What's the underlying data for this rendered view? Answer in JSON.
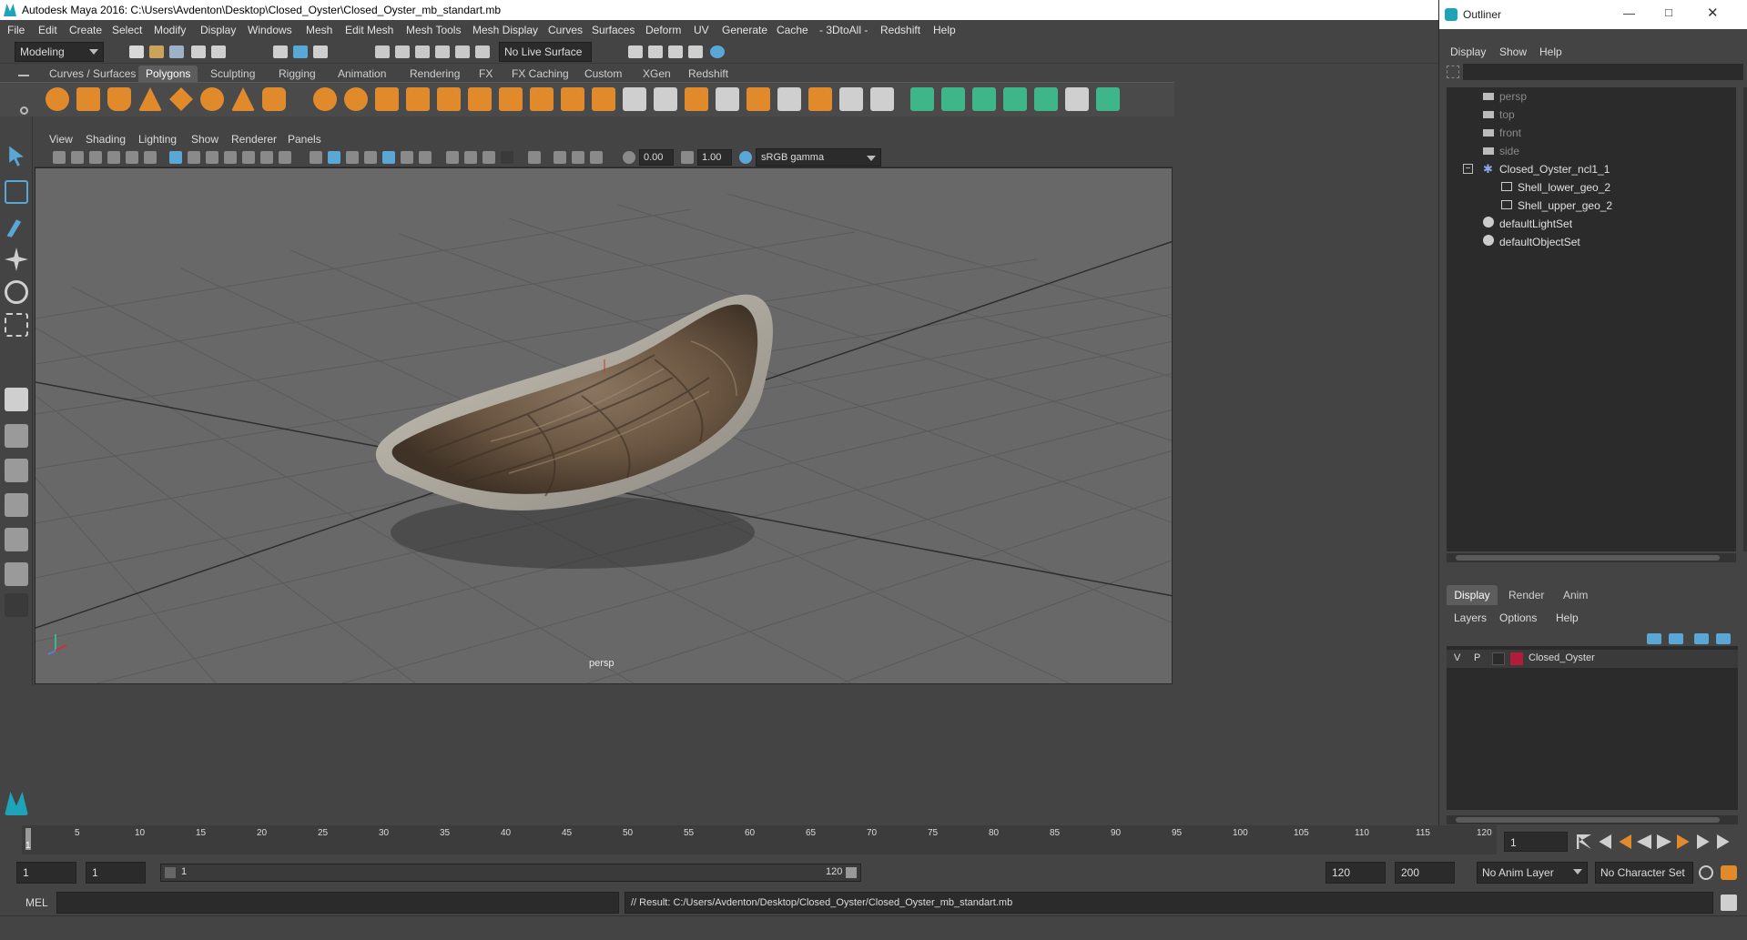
{
  "window": {
    "title": "Autodesk Maya 2016: C:\\Users\\Avdenton\\Desktop\\Closed_Oyster\\Closed_Oyster_mb_standart.mb"
  },
  "menubar": [
    "File",
    "Edit",
    "Create",
    "Select",
    "Modify",
    "Display",
    "Windows",
    "Mesh",
    "Edit Mesh",
    "Mesh Tools",
    "Mesh Display",
    "Curves",
    "Surfaces",
    "Deform",
    "UV",
    "Generate",
    "Cache",
    "- 3DtoAll -",
    "Redshift",
    "Help"
  ],
  "statusline": {
    "mode": "Modeling",
    "live_surface": "No Live Surface"
  },
  "shelf": {
    "tabs": [
      "Curves / Surfaces",
      "Polygons",
      "Sculpting",
      "Rigging",
      "Animation",
      "Rendering",
      "FX",
      "FX Caching",
      "Custom",
      "XGen",
      "Redshift"
    ],
    "active_tab": "Polygons"
  },
  "viewport": {
    "menu": [
      "View",
      "Shading",
      "Lighting",
      "Show",
      "Renderer",
      "Panels"
    ],
    "exposure": "0.00",
    "gamma": "1.00",
    "color_space": "sRGB gamma",
    "camera_label": "persp"
  },
  "outliner": {
    "title": "Outliner",
    "menu": [
      "Display",
      "Show",
      "Help"
    ],
    "items": [
      {
        "label": "persp",
        "dim": true
      },
      {
        "label": "top",
        "dim": true
      },
      {
        "label": "front",
        "dim": true
      },
      {
        "label": "side",
        "dim": true
      },
      {
        "label": "Closed_Oyster_ncl1_1",
        "dim": false
      },
      {
        "label": "Shell_lower_geo_2",
        "dim": false
      },
      {
        "label": "Shell_upper_geo_2",
        "dim": false
      },
      {
        "label": "defaultLightSet",
        "dim": false
      },
      {
        "label": "defaultObjectSet",
        "dim": false
      }
    ]
  },
  "layer_editor": {
    "tabs": [
      "Display",
      "Render",
      "Anim"
    ],
    "menu": [
      "Layers",
      "Options",
      "Help"
    ],
    "layer": {
      "visible": "V",
      "playback": "P",
      "name": "Closed_Oyster",
      "color": "#b01c3a"
    }
  },
  "timeline": {
    "ticks": [
      "1",
      "5",
      "10",
      "15",
      "20",
      "25",
      "30",
      "35",
      "40",
      "45",
      "50",
      "55",
      "60",
      "65",
      "70",
      "75",
      "80",
      "85",
      "90",
      "95",
      "100",
      "105",
      "110",
      "115",
      "120"
    ],
    "current_frame": "1"
  },
  "range": {
    "start": "1",
    "start_inner": "1",
    "slider_start": "1",
    "slider_end": "120",
    "end_inner": "120",
    "end": "200",
    "anim_layer": "No Anim Layer",
    "char_set": "No Character Set"
  },
  "command": {
    "lang": "MEL",
    "result": "// Result: C:/Users/Avdenton/Desktop/Closed_Oyster/Closed_Oyster_mb_standart.mb"
  },
  "colors": {
    "accent": "#5aa7d6",
    "shelf_green": "#3fb58a",
    "shelf_orange": "#e08a2c"
  }
}
